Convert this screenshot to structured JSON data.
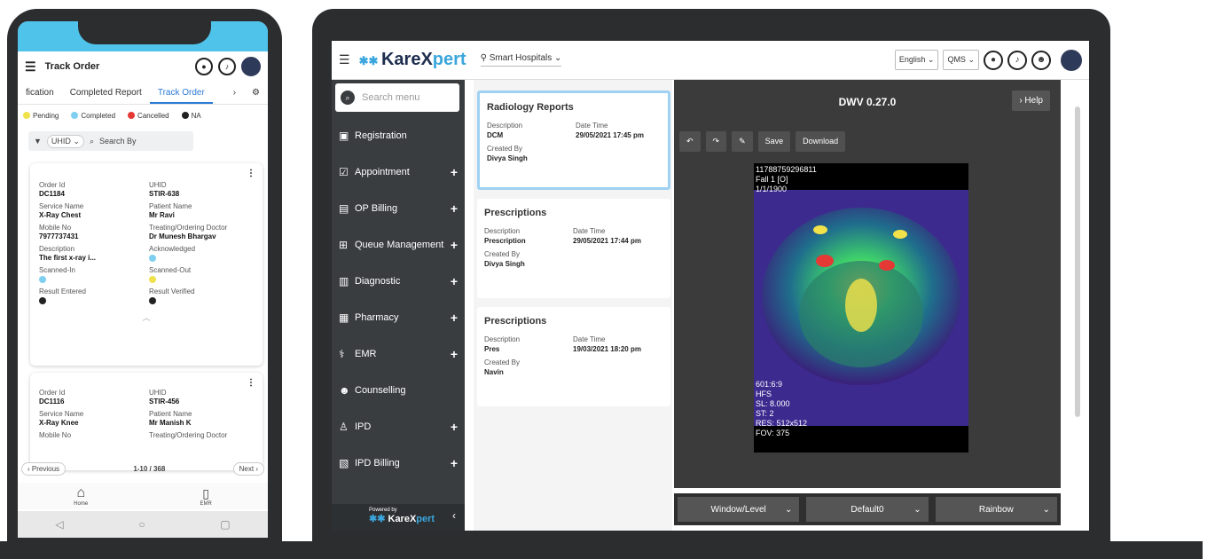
{
  "phone": {
    "header_title": "Track Order",
    "tabs": [
      "fication",
      "Completed Report",
      "Track Order"
    ],
    "legend": [
      {
        "label": "Pending",
        "color": "#f0e24a"
      },
      {
        "label": "Completed",
        "color": "#7fd0f0"
      },
      {
        "label": "Cancelled",
        "color": "#e53935"
      },
      {
        "label": "NA",
        "color": "#222222"
      }
    ],
    "search_filter": "UHID",
    "search_placeholder": "Search By",
    "card1": {
      "order_id_label": "Order Id",
      "order_id": "DC1184",
      "uhid_label": "UHID",
      "uhid": "STIR-638",
      "service_label": "Service Name",
      "service": "X-Ray Chest",
      "patient_label": "Patient Name",
      "patient": "Mr Ravi",
      "mobile_label": "Mobile No",
      "mobile": "7977737431",
      "doctor_label": "Treating/Ordering Doctor",
      "doctor": "Dr Munesh Bhargav",
      "desc_label": "Description",
      "desc": "The first x-ray i...",
      "ack_label": "Acknowledged",
      "scan_in_label": "Scanned-In",
      "scan_out_label": "Scanned-Out",
      "result_entered_label": "Result Entered",
      "result_verified_label": "Result Verified"
    },
    "card2": {
      "order_id_label": "Order Id",
      "order_id": "DC1116",
      "uhid_label": "UHID",
      "uhid": "STIR-456",
      "service_label": "Service Name",
      "service": "X-Ray Knee",
      "patient_label": "Patient Name",
      "patient": "Mr Manish K",
      "mobile_label": "Mobile No",
      "doctor_label": "Treating/Ordering Doctor"
    },
    "pager": {
      "prev": "‹ Previous",
      "count": "1-10 / 368",
      "next": "Next ›"
    },
    "bottom_nav": [
      "Home",
      "EMR"
    ]
  },
  "app": {
    "brand_a": "KareX",
    "brand_b": "pert",
    "location": "Smart Hospitals",
    "language": "English",
    "qms": "QMS",
    "side_search_placeholder": "Search menu",
    "menu": [
      {
        "label": "Registration",
        "icon": "registration-icon",
        "glyph": "▣",
        "plus": ""
      },
      {
        "label": "Appointment",
        "icon": "appointment-icon",
        "glyph": "☑",
        "plus": "+"
      },
      {
        "label": "OP Billing",
        "icon": "op-billing-icon",
        "glyph": "▤",
        "plus": "+"
      },
      {
        "label": "Queue Management",
        "icon": "queue-icon",
        "glyph": "⊞",
        "plus": "+"
      },
      {
        "label": "Diagnostic",
        "icon": "diagnostic-icon",
        "glyph": "▥",
        "plus": "+"
      },
      {
        "label": "Pharmacy",
        "icon": "pharmacy-icon",
        "glyph": "▦",
        "plus": "+"
      },
      {
        "label": "EMR",
        "icon": "emr-icon",
        "glyph": "⚕",
        "plus": "+"
      },
      {
        "label": "Counselling",
        "icon": "counselling-icon",
        "glyph": "☻",
        "plus": ""
      },
      {
        "label": "IPD",
        "icon": "ipd-icon",
        "glyph": "♙",
        "plus": "+"
      },
      {
        "label": "IPD Billing",
        "icon": "ipd-billing-icon",
        "glyph": "▧",
        "plus": "+"
      }
    ],
    "powered_by": "Powered by",
    "reports": [
      {
        "title": "Radiology Reports",
        "desc_label": "Description",
        "desc": "DCM",
        "date_label": "Date Time",
        "date": "29/05/2021 17:45 pm",
        "by_label": "Created By",
        "by": "Divya Singh"
      },
      {
        "title": "Prescriptions",
        "desc_label": "Description",
        "desc": "Prescription",
        "date_label": "Date Time",
        "date": "29/05/2021 17:44 pm",
        "by_label": "Created By",
        "by": "Divya Singh"
      },
      {
        "title": "Prescriptions",
        "desc_label": "Description",
        "desc": "Pres",
        "date_label": "Date Time",
        "date": "19/03/2021 18:20 pm",
        "by_label": "Created By",
        "by": "Navin"
      }
    ],
    "viewer": {
      "title": "DWV 0.27.0",
      "help": "Help",
      "save": "Save",
      "download": "Download",
      "overlay_top": [
        "11788759296811",
        "Fall 1 [O]",
        "1/1/1900"
      ],
      "overlay_bottom": [
        "601:6:9",
        "HFS",
        "SL: 8.000",
        "ST: 2",
        "RES: 512x512",
        "FOV: 375"
      ],
      "selects": [
        "Window/Level",
        "Default0",
        "Rainbow"
      ]
    }
  }
}
